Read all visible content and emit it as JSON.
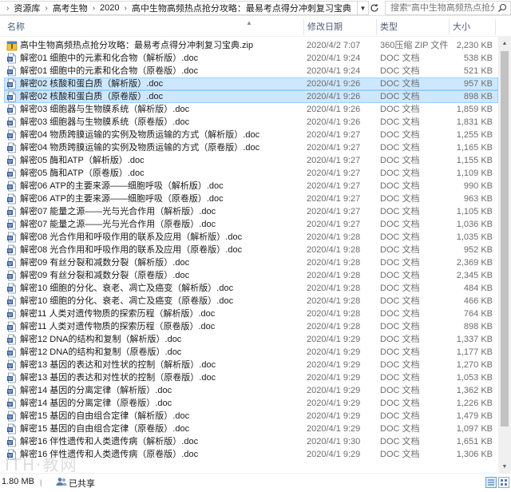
{
  "breadcrumb": [
    "资源库",
    "高考生物",
    "2020",
    "高中生物高频热点抢分攻略：最易考点得分冲刺复习宝典"
  ],
  "search": {
    "placeholder": "搜索\"高中生物高频热点抢分...\""
  },
  "columns": {
    "name": "名称",
    "date": "修改日期",
    "type": "类型",
    "size": "大小"
  },
  "files": [
    {
      "name": "高中生物高频热点抢分攻略：最易考点得分冲刺复习宝典.zip",
      "date": "2020/4/2 7:07",
      "type": "360压缩 ZIP 文件",
      "size": "2,230 KB",
      "icon": "zip-icon",
      "selected": false
    },
    {
      "name": "解密01 细胞中的元素和化合物（解析版）.doc",
      "date": "2020/4/1 9:24",
      "type": "DOC 文档",
      "size": "538 KB",
      "icon": "doc-icon",
      "selected": false
    },
    {
      "name": "解密01 细胞中的元素和化合物（原卷版）.doc",
      "date": "2020/4/1 9:24",
      "type": "DOC 文档",
      "size": "521 KB",
      "icon": "doc-icon",
      "selected": false
    },
    {
      "name": "解密02 核酸和蛋白质（解析版）.doc",
      "date": "2020/4/1 9:26",
      "type": "DOC 文档",
      "size": "957 KB",
      "icon": "doc-icon",
      "selected": true
    },
    {
      "name": "解密02 核酸和蛋白质（原卷版）.doc",
      "date": "2020/4/1 9:26",
      "type": "DOC 文档",
      "size": "898 KB",
      "icon": "doc-icon",
      "selected": true
    },
    {
      "name": "解密03 细胞器与生物膜系统（解析版）.doc",
      "date": "2020/4/1 9:26",
      "type": "DOC 文档",
      "size": "1,859 KB",
      "icon": "doc-icon",
      "selected": false
    },
    {
      "name": "解密03 细胞器与生物膜系统（原卷版）.doc",
      "date": "2020/4/1 9:26",
      "type": "DOC 文档",
      "size": "1,831 KB",
      "icon": "doc-icon",
      "selected": false
    },
    {
      "name": "解密04 物质跨膜运输的实例及物质运输的方式（解析版）.doc",
      "date": "2020/4/1 9:27",
      "type": "DOC 文档",
      "size": "1,255 KB",
      "icon": "doc-icon",
      "selected": false
    },
    {
      "name": "解密04 物质跨膜运输的实例及物质运输的方式（原卷版）.doc",
      "date": "2020/4/1 9:27",
      "type": "DOC 文档",
      "size": "1,165 KB",
      "icon": "doc-icon",
      "selected": false
    },
    {
      "name": "解密05 酶和ATP（解析版）.doc",
      "date": "2020/4/1 9:27",
      "type": "DOC 文档",
      "size": "1,155 KB",
      "icon": "doc-icon",
      "selected": false
    },
    {
      "name": "解密05 酶和ATP（原卷版）.doc",
      "date": "2020/4/1 9:27",
      "type": "DOC 文档",
      "size": "1,109 KB",
      "icon": "doc-icon",
      "selected": false
    },
    {
      "name": "解密06 ATP的主要来源——细胞呼吸（解析版）.doc",
      "date": "2020/4/1 9:27",
      "type": "DOC 文档",
      "size": "990 KB",
      "icon": "doc-icon",
      "selected": false
    },
    {
      "name": "解密06 ATP的主要来源——细胞呼吸（原卷版）.doc",
      "date": "2020/4/1 9:27",
      "type": "DOC 文档",
      "size": "963 KB",
      "icon": "doc-icon",
      "selected": false
    },
    {
      "name": "解密07 能量之源——光与光合作用（解析版）.doc",
      "date": "2020/4/1 9:27",
      "type": "DOC 文档",
      "size": "1,105 KB",
      "icon": "doc-icon",
      "selected": false
    },
    {
      "name": "解密07 能量之源——光与光合作用（原卷版）.doc",
      "date": "2020/4/1 9:27",
      "type": "DOC 文档",
      "size": "1,036 KB",
      "icon": "doc-icon",
      "selected": false
    },
    {
      "name": "解密08 光合作用和呼吸作用的联系及应用（解析版）.doc",
      "date": "2020/4/1 9:28",
      "type": "DOC 文档",
      "size": "1,035 KB",
      "icon": "doc-icon",
      "selected": false
    },
    {
      "name": "解密08 光合作用和呼吸作用的联系及应用（原卷版）.doc",
      "date": "2020/4/1 9:28",
      "type": "DOC 文档",
      "size": "952 KB",
      "icon": "doc-icon",
      "selected": false
    },
    {
      "name": "解密09 有丝分裂和减数分裂（解析版）.doc",
      "date": "2020/4/1 9:28",
      "type": "DOC 文档",
      "size": "2,369 KB",
      "icon": "doc-icon",
      "selected": false
    },
    {
      "name": "解密09 有丝分裂和减数分裂（原卷版）.doc",
      "date": "2020/4/1 9:28",
      "type": "DOC 文档",
      "size": "2,345 KB",
      "icon": "doc-icon",
      "selected": false
    },
    {
      "name": "解密10 细胞的分化、衰老、凋亡及癌变（解析版）.doc",
      "date": "2020/4/1 9:28",
      "type": "DOC 文档",
      "size": "484 KB",
      "icon": "doc-icon",
      "selected": false
    },
    {
      "name": "解密10 细胞的分化、衰老、凋亡及癌变（原卷版）.doc",
      "date": "2020/4/1 9:28",
      "type": "DOC 文档",
      "size": "466 KB",
      "icon": "doc-icon",
      "selected": false
    },
    {
      "name": "解密11 人类对遗传物质的探索历程（解析版）.doc",
      "date": "2020/4/1 9:28",
      "type": "DOC 文档",
      "size": "764 KB",
      "icon": "doc-icon",
      "selected": false
    },
    {
      "name": "解密11 人类对遗传物质的探索历程（原卷版）.doc",
      "date": "2020/4/1 9:28",
      "type": "DOC 文档",
      "size": "898 KB",
      "icon": "doc-icon",
      "selected": false
    },
    {
      "name": "解密12 DNA的结构和复制（解析版）.doc",
      "date": "2020/4/1 9:29",
      "type": "DOC 文档",
      "size": "1,337 KB",
      "icon": "doc-icon",
      "selected": false
    },
    {
      "name": "解密12 DNA的结构和复制（原卷版）.doc",
      "date": "2020/4/1 9:29",
      "type": "DOC 文档",
      "size": "1,177 KB",
      "icon": "doc-icon",
      "selected": false
    },
    {
      "name": "解密13 基因的表达和对性状的控制（解析版）.doc",
      "date": "2020/4/1 9:29",
      "type": "DOC 文档",
      "size": "1,270 KB",
      "icon": "doc-icon",
      "selected": false
    },
    {
      "name": "解密13 基因的表达和对性状的控制（原卷版）.doc",
      "date": "2020/4/1 9:29",
      "type": "DOC 文档",
      "size": "1,053 KB",
      "icon": "doc-icon",
      "selected": false
    },
    {
      "name": "解密14 基因的分离定律（解析版）.doc",
      "date": "2020/4/1 9:29",
      "type": "DOC 文档",
      "size": "1,362 KB",
      "icon": "doc-icon",
      "selected": false
    },
    {
      "name": "解密14 基因的分离定律（原卷版）.doc",
      "date": "2020/4/1 9:29",
      "type": "DOC 文档",
      "size": "1,226 KB",
      "icon": "doc-icon",
      "selected": false
    },
    {
      "name": "解密15 基因的自由组合定律（解析版）.doc",
      "date": "2020/4/1 9:29",
      "type": "DOC 文档",
      "size": "1,479 KB",
      "icon": "doc-icon",
      "selected": false
    },
    {
      "name": "解密15 基因的自由组合定律（原卷版）.doc",
      "date": "2020/4/1 9:29",
      "type": "DOC 文档",
      "size": "1,097 KB",
      "icon": "doc-icon",
      "selected": false
    },
    {
      "name": "解密16 伴性遗传和人类遗传病（解析版）.doc",
      "date": "2020/4/1 9:30",
      "type": "DOC 文档",
      "size": "1,651 KB",
      "icon": "doc-icon",
      "selected": false
    },
    {
      "name": "解密16 伴性遗传和人类遗传病（原卷版）.doc",
      "date": "2020/4/1 9:29",
      "type": "DOC 文档",
      "size": "1,306 KB",
      "icon": "doc-icon",
      "selected": false
    }
  ],
  "status": {
    "selection_size": "1.80 MB",
    "shared": "已共享"
  },
  "colors": {
    "selection": "#cce8ff",
    "selection_border": "#99d1ff",
    "header_text": "#4c607a",
    "doc_icon": "#2b579a"
  }
}
